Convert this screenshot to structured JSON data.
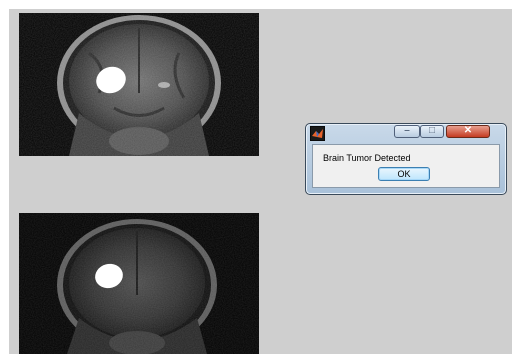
{
  "dialog": {
    "message": "Brain Tumor Detected",
    "ok_label": "OK",
    "icons": {
      "app": "matlab-icon",
      "minimize": "minimize-icon",
      "maximize": "maximize-icon",
      "close": "close-icon"
    },
    "close_glyph": "✕",
    "minimize_glyph": "–",
    "maximize_glyph": "□"
  },
  "images": [
    {
      "name": "mri-top",
      "content": "coronal brain MRI with bright tumor region"
    },
    {
      "name": "mri-bottom",
      "content": "coronal brain MRI with segmented tumor region"
    }
  ],
  "colors": {
    "figure_bg": "#cfcfcf",
    "close_button": "#c43b22",
    "tumor": "#ffffff"
  }
}
